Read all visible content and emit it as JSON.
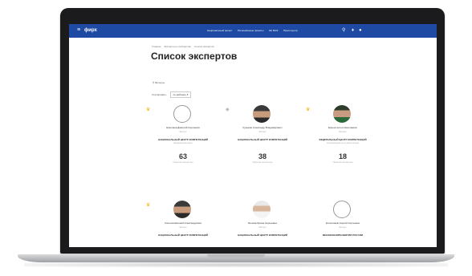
{
  "header": {
    "menu_icon": "≡",
    "logo": "фирх",
    "nav": [
      "Национальный проект",
      "Региональные проекты",
      "ЕК ФАЭ",
      "Пресс-центр"
    ],
    "icons": [
      "search-icon",
      "bell-icon",
      "user-icon"
    ]
  },
  "breadcrumb": [
    "Главная",
    "Экспертное сообщество",
    "Список экспертов"
  ],
  "page_title": "Список экспертов",
  "filters": {
    "search_label": "Фильтры",
    "sort_label": "Сортировать:",
    "sort_value": "по рейтингу ▾"
  },
  "experts": [
    {
      "name": "Николаев Дмитрий Сергеевич",
      "role": "Эксперт",
      "org": "НАЦИОНАЛЬНЫЙ ЦЕНТР КОМПЕТЕНЦИЙ",
      "org_sub": "Федеральный центр",
      "count": "63",
      "count_label": "Проектов экспертизы",
      "crown": true,
      "avatar": "outline"
    },
    {
      "name": "Кузьмин Александр Владимирович",
      "role": "Эксперт",
      "org": "НАЦИОНАЛЬНЫЙ ЦЕНТР КОМПЕТЕНЦИЙ",
      "org_sub": "",
      "count": "38",
      "count_label": "Проектов экспертизы",
      "crown": false,
      "avatar": "photo"
    },
    {
      "name": "Ершов Антон Николаевич",
      "role": "Эксперт",
      "org": "ФЕДЕРАЛЬНЫЙ ЦЕНТР КОМПЕТЕНЦИЙ",
      "org_sub": "Региональный центр компетенций",
      "count": "18",
      "count_label": "Проектов экспертизы",
      "crown": true,
      "avatar": "green"
    },
    {
      "name": "Соколов Евгений Александрович",
      "role": "Эксперт",
      "org": "НАЦИОНАЛЬНЫЙ ЦЕНТР КОМПЕТЕНЦИЙ",
      "org_sub": "",
      "count": "",
      "count_label": "",
      "crown": true,
      "avatar": "photo"
    },
    {
      "name": "Белова Ирина Сергеевна",
      "role": "Эксперт",
      "org": "НАЦИОНАЛЬНЫЙ ЦЕНТР КОМПЕТЕНЦИЙ",
      "org_sub": "",
      "count": "",
      "count_label": "",
      "crown": false,
      "avatar": "white"
    },
    {
      "name": "Колесников Сергей Сергеевич",
      "role": "Эксперт",
      "org": "МИНЭКОНОМРАЗВИТИЯ РОССИИ",
      "org_sub": "",
      "count": "",
      "count_label": "",
      "crown": false,
      "avatar": "outline"
    }
  ],
  "colors": {
    "header_bg": "#1e4aa3",
    "crown": "#f0b400"
  }
}
